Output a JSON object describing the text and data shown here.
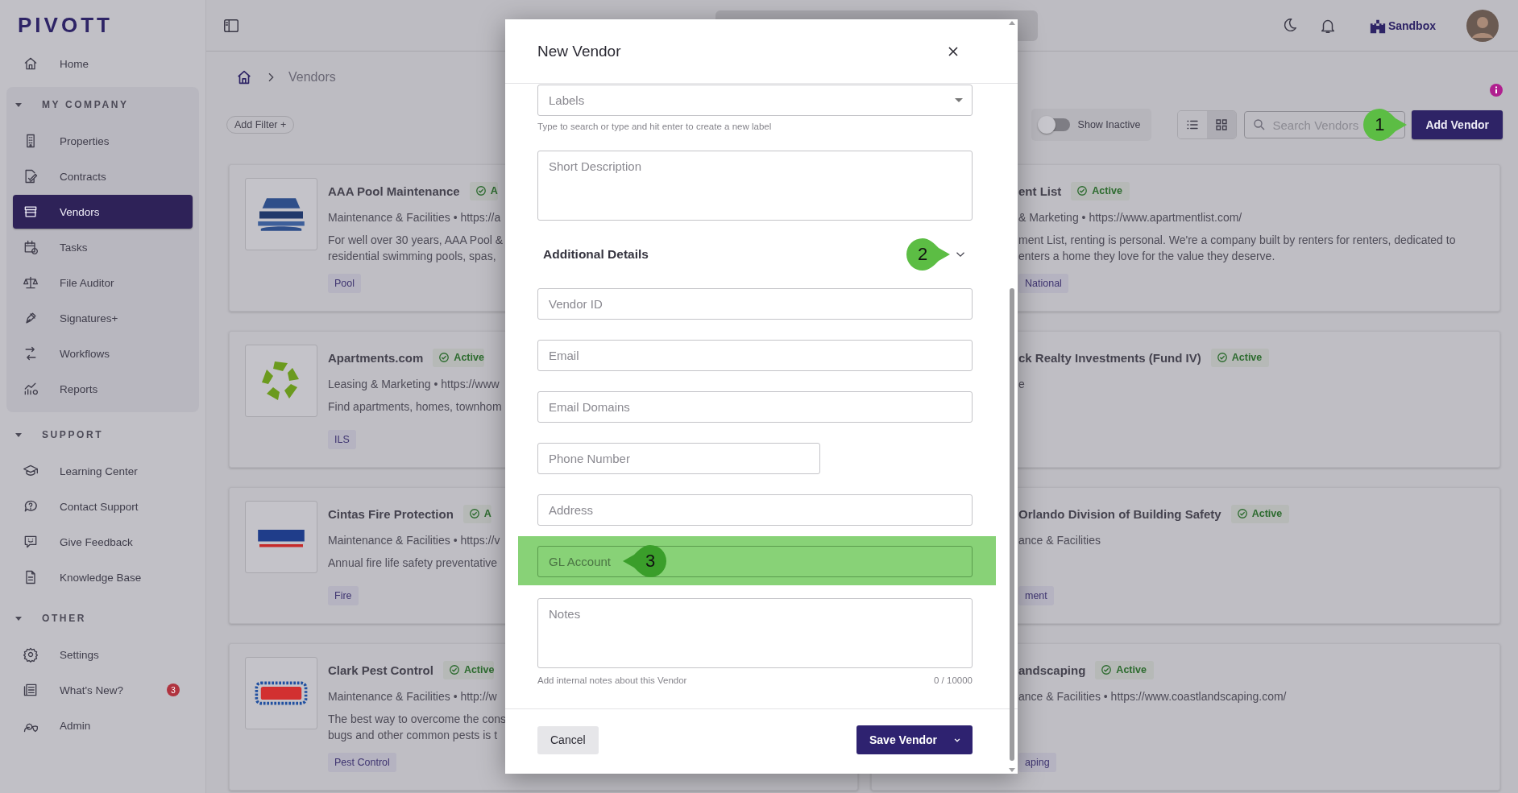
{
  "sidebar": {
    "logo": "PIVOTT",
    "items": [
      {
        "label": "Home",
        "selected": false
      }
    ],
    "groups": [
      {
        "title": "MY COMPANY",
        "expanded": true,
        "items": [
          {
            "label": "Properties",
            "selected": false
          },
          {
            "label": "Contracts",
            "selected": false
          },
          {
            "label": "Vendors",
            "selected": true
          },
          {
            "label": "Tasks",
            "selected": false
          },
          {
            "label": "File Auditor",
            "selected": false
          },
          {
            "label": "Signatures+",
            "selected": false
          },
          {
            "label": "Workflows",
            "selected": false
          },
          {
            "label": "Reports",
            "selected": false
          }
        ]
      },
      {
        "title": "SUPPORT",
        "expanded": true,
        "items": [
          {
            "label": "Learning Center",
            "selected": false
          },
          {
            "label": "Contact Support",
            "selected": false
          },
          {
            "label": "Give Feedback",
            "selected": false
          },
          {
            "label": "Knowledge Base",
            "selected": false
          }
        ]
      },
      {
        "title": "OTHER",
        "expanded": true,
        "items": [
          {
            "label": "Settings",
            "selected": false
          },
          {
            "label": "What's New?",
            "selected": false,
            "badge": "3"
          },
          {
            "label": "Admin",
            "selected": false
          }
        ]
      }
    ]
  },
  "header": {
    "workspace": "Sandbox"
  },
  "breadcrumb": {
    "current": "Vendors"
  },
  "toolbar": {
    "add_filter": "Add Filter +",
    "show_inactive": {
      "label": "Show Inactive",
      "on": false
    },
    "views": [
      {
        "kind": "list",
        "selected": false
      },
      {
        "kind": "grid",
        "selected": true
      }
    ],
    "search": {
      "placeholder": "Search Vendors"
    },
    "add_button": {
      "label": "Add Vendor",
      "callout": "1"
    }
  },
  "vendors_left": [
    {
      "name": "AAA Pool Maintenance",
      "status": "A",
      "meta": "Maintenance & Facilities • https://a",
      "description": [
        "For well over 30 years, AAA Pool &",
        "residential swimming pools, spas,"
      ],
      "tag": "Pool"
    },
    {
      "name": "Apartments.com",
      "status": "Active",
      "meta": "Leasing & Marketing • https://www",
      "description": [
        "Find apartments, homes, townhom"
      ],
      "tag": "ILS"
    },
    {
      "name": "Cintas Fire Protection",
      "status": "A",
      "meta": "Maintenance & Facilities • https://v",
      "description": [
        "Annual fire life safety preventative"
      ],
      "tag": "Fire"
    },
    {
      "name": "Clark Pest Control",
      "status": "Active",
      "meta": "Maintenance & Facilities • http://w",
      "description": [
        "The best way to overcome the cons",
        "bugs and other common pests is t"
      ],
      "tag": "Pest Control"
    }
  ],
  "vendors_right": [
    {
      "name": "ent List",
      "status": "Active",
      "meta": "& Marketing • https://www.apartmentlist.com/",
      "description": [
        "ment List, renting is personal. We're a company built by renters for renters, dedicated to",
        "enters a home they love for the value they deserve."
      ],
      "tag": "National"
    },
    {
      "name": "ck Realty Investments (Fund IV)",
      "status": "Active",
      "meta": "e"
    },
    {
      "name": "Orlando Division of Building Safety",
      "status": "Active",
      "meta": "ance & Facilities",
      "tag": "ment"
    },
    {
      "name": "andscaping",
      "status": "Active",
      "meta": "ance & Facilities • https://www.coastlandscaping.com/",
      "tag": "aping"
    }
  ],
  "modal": {
    "title": "New Vendor",
    "labels": {
      "placeholder": "Labels",
      "hint": "Type to search or type and hit enter to create a new label"
    },
    "short_description": {
      "placeholder": "Short Description"
    },
    "details": {
      "title": "Additional Details",
      "expanded": true,
      "callout": "2"
    },
    "fields": [
      {
        "placeholder": "Vendor ID",
        "kind": "full"
      },
      {
        "placeholder": "Email",
        "kind": "full"
      },
      {
        "placeholder": "Email Domains",
        "kind": "full"
      },
      {
        "placeholder": "Phone Number",
        "kind": "half"
      },
      {
        "placeholder": "Address",
        "kind": "full"
      },
      {
        "placeholder": "GL Account",
        "kind": "full",
        "highlighted": true,
        "callout": "3"
      }
    ],
    "notes": {
      "placeholder": "Notes",
      "hint": "Add internal notes about this Vendor",
      "counter": "0 / 10000"
    },
    "cancel": "Cancel",
    "save": "Save Vendor"
  }
}
